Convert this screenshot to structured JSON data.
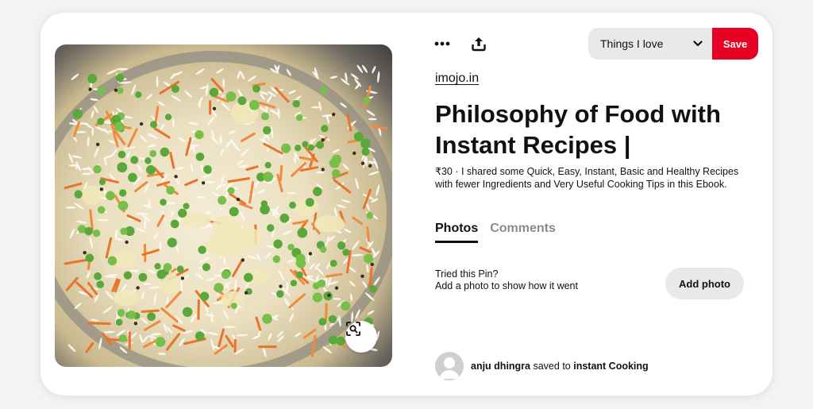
{
  "pin": {
    "image": {
      "alt": "vegetable pulao with peas and carrots"
    },
    "source_link": "imojo.in",
    "title": "Philosophy of Food with Instant Recipes |",
    "description": "₹30 · I shared some Quick, Easy, Instant, Basic and Healthy Recipes with fewer Ingredients and Very Useful Cooking Tips in this Ebook."
  },
  "toolbar": {
    "more_icon": "ellipsis-icon",
    "share_icon": "share-icon",
    "board_label": "Things I love",
    "save_label": "Save"
  },
  "tabs": [
    {
      "label": "Photos",
      "active": true
    },
    {
      "label": "Comments",
      "active": false
    }
  ],
  "tried": {
    "line1": "Tried this Pin?",
    "line2": "Add a photo to show how it went",
    "button_label": "Add photo"
  },
  "saved_by": {
    "user": "anju dhingra",
    "middle": "saved to",
    "board": "instant Cooking"
  },
  "colors": {
    "accent": "#e60023",
    "button_bg": "#e9e9e9"
  }
}
